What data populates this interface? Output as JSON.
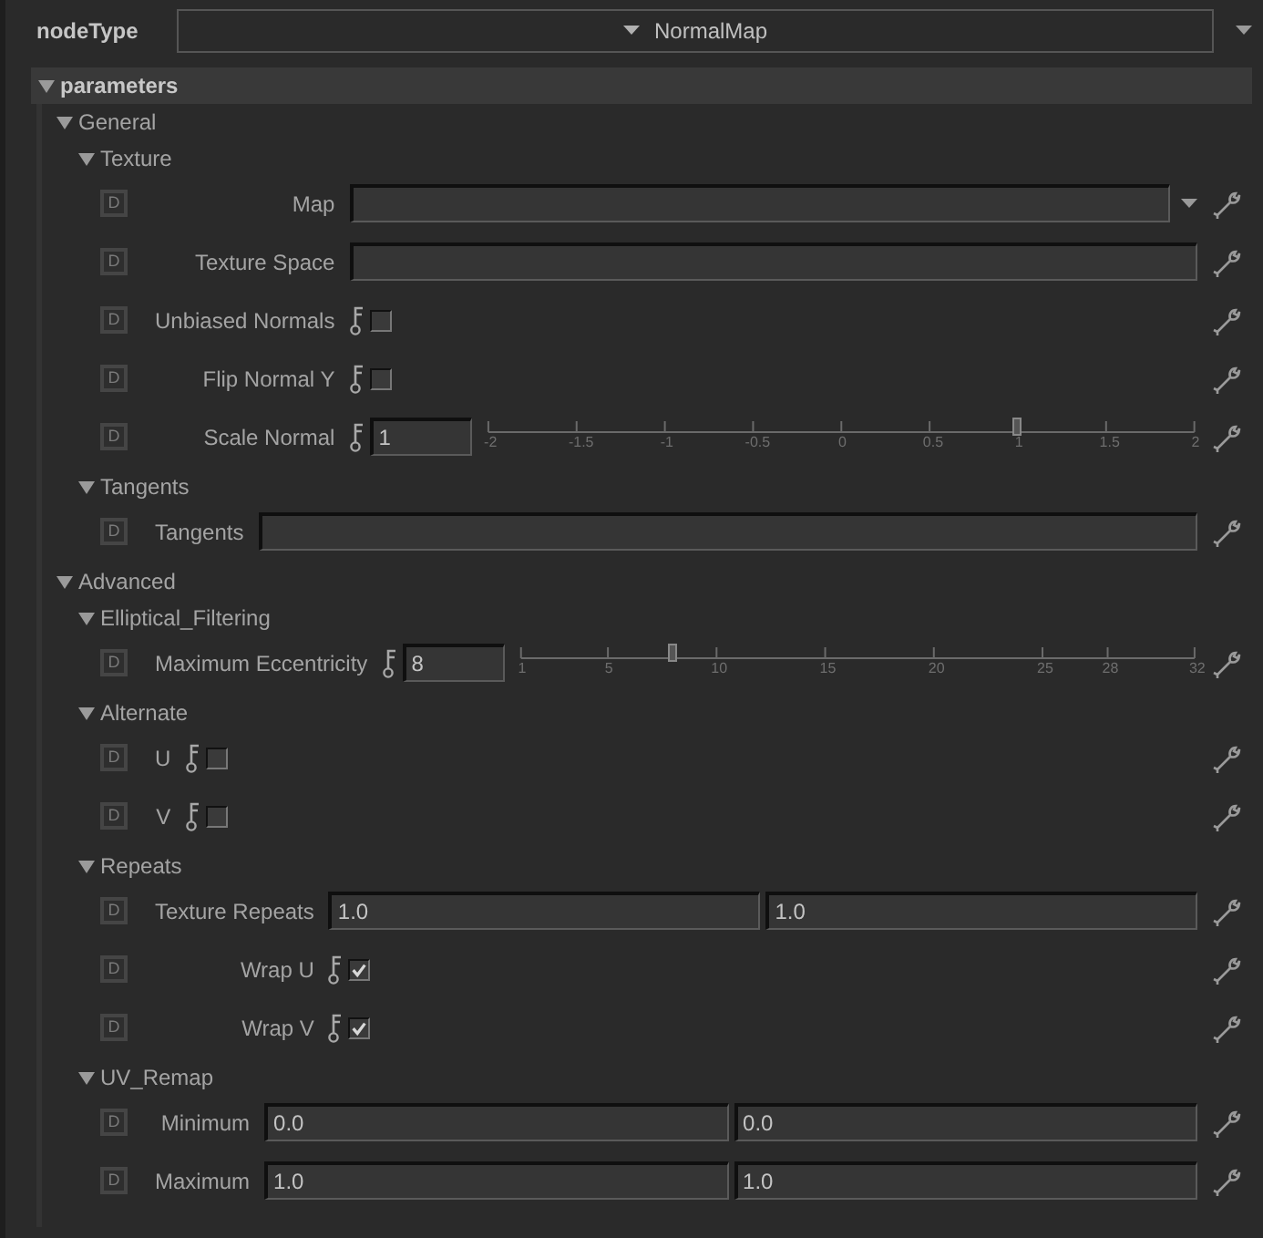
{
  "node_type": {
    "label": "nodeType",
    "value": "NormalMap"
  },
  "parameters": {
    "title": "parameters",
    "expanded": true,
    "groups": [
      {
        "title": "General",
        "expanded": true,
        "children": [
          {
            "title": "Texture",
            "expanded": true,
            "params": [
              {
                "kind": "menu",
                "badge": "D",
                "label": "Map"
              },
              {
                "kind": "text",
                "badge": "D",
                "label": "Texture Space"
              },
              {
                "kind": "checkbox",
                "badge": "D",
                "label": "Unbiased Normals",
                "checked": false
              },
              {
                "kind": "checkbox",
                "badge": "D",
                "label": "Flip Normal Y",
                "checked": false
              },
              {
                "kind": "slider",
                "badge": "D",
                "label": "Scale Normal",
                "value": "1",
                "level": 0.75,
                "ticks": [
                  "-2",
                  "-1.5",
                  "-1",
                  "-0.5",
                  "0",
                  "0.5",
                  "1",
                  "1.5",
                  "2"
                ]
              }
            ]
          },
          {
            "title": "Tangents",
            "expanded": true,
            "params": [
              {
                "kind": "text",
                "badge": "D",
                "label": "Tangents"
              }
            ]
          }
        ]
      },
      {
        "title": "Advanced",
        "expanded": true,
        "children": [
          {
            "title": "Elliptical_Filtering",
            "expanded": true,
            "params": [
              {
                "kind": "slider",
                "badge": "D",
                "label": "Maximum Eccentricity",
                "value": "8",
                "level": 0.226,
                "ticks": [
                  "1",
                  "5",
                  "10",
                  "15",
                  "20",
                  "25",
                  "28",
                  "32"
                ]
              }
            ]
          },
          {
            "title": "Alternate",
            "expanded": true,
            "params": [
              {
                "kind": "checkbox",
                "badge": "D",
                "label": "U",
                "checked": false
              },
              {
                "kind": "checkbox",
                "badge": "D",
                "label": "V",
                "checked": false
              }
            ]
          },
          {
            "title": "Repeats",
            "expanded": true,
            "params": [
              {
                "kind": "pair",
                "badge": "D",
                "label": "Texture Repeats",
                "values": [
                  "1.0",
                  "1.0"
                ]
              },
              {
                "kind": "checkbox",
                "badge": "D",
                "label": "Wrap U",
                "checked": true
              },
              {
                "kind": "checkbox",
                "badge": "D",
                "label": "Wrap V",
                "checked": true
              }
            ]
          },
          {
            "title": "UV_Remap",
            "expanded": true,
            "params": [
              {
                "kind": "pair",
                "badge": "D",
                "label": "Minimum",
                "values": [
                  "0.0",
                  "0.0"
                ]
              },
              {
                "kind": "pair",
                "badge": "D",
                "label": "Maximum",
                "values": [
                  "1.0",
                  "1.0"
                ]
              }
            ]
          }
        ]
      }
    ]
  }
}
